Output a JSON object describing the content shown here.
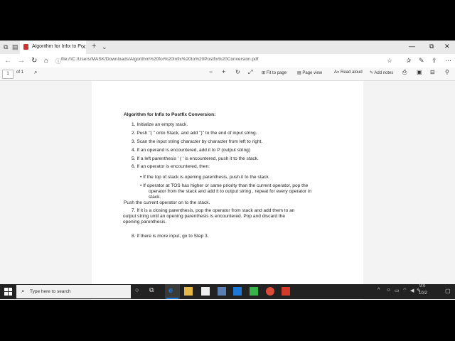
{
  "browser": {
    "tab_title": "Algorithm for Infix to Po",
    "url": "file:///C:/Users/MASK/Downloads/Algorithm%20for%20Infix%20to%20Postfix%20Conversion.pdf",
    "window_min": "—",
    "window_restore": "⧉",
    "window_close": "✕"
  },
  "pdf_toolbar": {
    "page_number": "1",
    "page_total": "of 1",
    "fit_to_page": "Fit to page",
    "page_view": "Page view",
    "read_aloud": "Read aloud",
    "add_notes": "Add notes"
  },
  "doc": {
    "title": "Algorithm for Infix to Postfix Conversion:",
    "step1": "1. Initialize an empty stack.",
    "step2": "2. Push \"( \" onto Stack, and add \")\" to the end of input string.",
    "step3": "3. Scan the input string character by character from left to right.",
    "step4": "4. If an operand is encountered, add it to P (output string)",
    "step5": "5. If a left parenthesis ' ( ' is encountered, push it to the stack.",
    "step6": "6. If an operator is encountered, then:",
    "bullet1": "• If the top of stack is opening parenthesis, push it to the stack",
    "bullet2_l1": "• If operator at TOS has higher or same priority than the current operator, pop  the",
    "bullet2_l2": "operator from the stack and add it to output string , repeat for every  operator in",
    "bullet2_l3": "stack.",
    "push_current": "Push the current operator on to the stack.",
    "step7_l1": "7. If it is a closing parenthesis, pop the operator from stack and add them to an",
    "step7_l2": "output  string until an opening parenthesis is encountered. Pop and discard the",
    "step7_l3": "opening  parenthesis.",
    "step8": "8. If there is more input, go to Step 3."
  },
  "taskbar": {
    "search_placeholder": "Type here to search",
    "time": "9:0",
    "date": "10/2"
  },
  "colors": {
    "edge_blue": "#1e78d8",
    "pdf_red": "#d23b2a"
  }
}
